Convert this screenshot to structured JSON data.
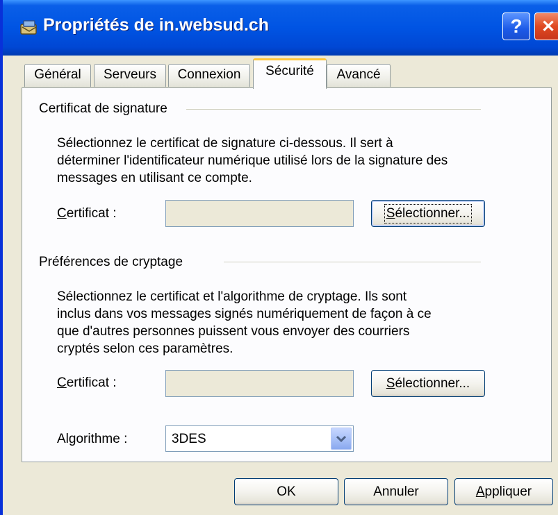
{
  "window": {
    "title": "Propriétés de in.websud.ch",
    "help_glyph": "?",
    "close_glyph": "✕"
  },
  "tabs": [
    {
      "label": "Général",
      "active": false
    },
    {
      "label": "Serveurs",
      "active": false
    },
    {
      "label": "Connexion",
      "active": false
    },
    {
      "label": "Sécurité",
      "active": true
    },
    {
      "label": "Avancé",
      "active": false
    }
  ],
  "signing": {
    "title": "Certificat de signature",
    "description_lines": [
      "Sélectionnez le certificat de signature ci-dessous. Il sert à",
      "déterminer l'identificateur numérique utilisé lors de la signature des",
      "messages en utilisant ce compte."
    ],
    "certificate_label_prefix": "C",
    "certificate_label_rest": "ertificat :",
    "certificate_value": "",
    "select_button_prefix": "S",
    "select_button_rest": "électionner..."
  },
  "encryption": {
    "title": "Préférences de cryptage",
    "description_lines": [
      "Sélectionnez le certificat et l'algorithme de cryptage. Ils sont",
      "inclus dans vos messages signés numériquement de façon à ce",
      "que d'autres personnes puissent vous envoyer des courriers",
      "cryptés selon ces paramètres."
    ],
    "certificate_label_prefix": "C",
    "certificate_label_rest": "ertificat :",
    "certificate_value": "",
    "select_button_prefix": "S",
    "select_button_rest": "électionner...",
    "algorithm_label": "Algorithme :",
    "algorithm_value": "3DES"
  },
  "footer": {
    "ok_label": "OK",
    "cancel_label": "Annuler",
    "apply_prefix": "A",
    "apply_rest": "ppliquer"
  },
  "icons": {
    "title": "account-properties-icon",
    "dropdown": "chevron-down-icon",
    "help": "help-icon",
    "close": "close-icon"
  },
  "colors": {
    "titlebar": "#0054e3",
    "dialog_bg": "#ece9d8",
    "panel_bg": "#fcfcfe",
    "active_tab_accent": "#ffc83c",
    "close_button": "#e04a22"
  }
}
